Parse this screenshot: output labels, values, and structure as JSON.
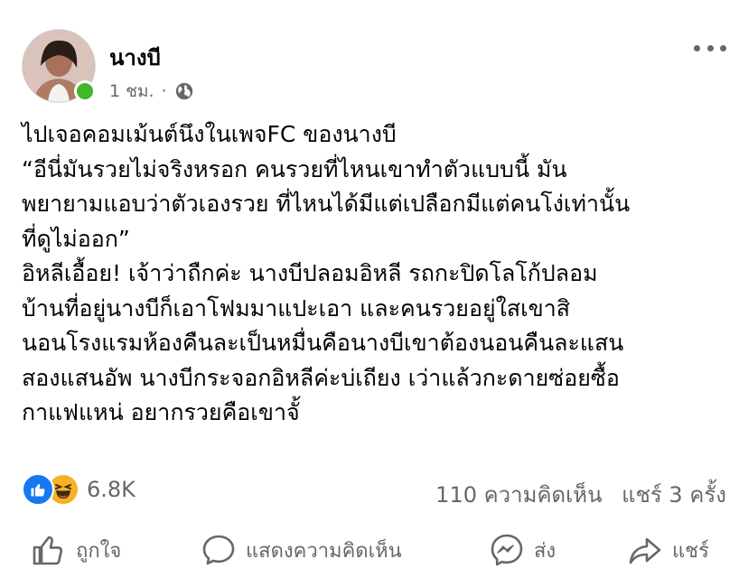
{
  "post": {
    "author": "นางบี",
    "time": "1 ชม.",
    "dot": "·",
    "lines": [
      "ไปเจอคอมเม้นต์นึงในเพจFC ของนางบี",
      "“อีนี่มันรวยไม่จริงหรอก คนรวยที่ไหนเขาทำตัวแบบนี้ มัน",
      "พยายามแอบว่าตัวเองรวย ที่ไหนได้มีแต่เปลือกมีแต่คนโง่เท่านั้น",
      "ที่ดูไม่ออก”",
      "อิหลีเอื้อย! เจ้าว่าถืกค่ะ นางบีปลอมอิหลี รถกะปิดโลโก้ปลอม",
      "บ้านที่อยู่นางบีก็เอาโฟมมาแปะเอา และคนรวยอยู่ใสเขาสิ",
      "นอนโรงแรมห้องคืนละเป็นหมื่นคือนางบีเขาต้องนอนคืนละแสน",
      "สองแสนอัพ นางบีกระจอกอิหลีค่ะบ่เถียง เว่าแล้วกะดายซ่อยซื้อ",
      "กาแฟแหน่ อยากรวยคือเขาจั้"
    ]
  },
  "stats": {
    "reaction_count": "6.8K",
    "comments": "110 ความคิดเห็น",
    "shares": "แชร์ 3 ครั้ง"
  },
  "actions": {
    "like": "ถูกใจ",
    "comment": "แสดงความคิดเห็น",
    "send": "ส่ง",
    "share": "แชร์"
  },
  "colors": {
    "online": "#42b72a",
    "like_blue": "#1877f2",
    "haha_yellow": "#f7b125",
    "secondary_text": "#65676b"
  },
  "icons": [
    "globe-icon",
    "more-icon",
    "like-reaction-icon",
    "haha-reaction-icon",
    "thumbs-up-icon",
    "comment-icon",
    "messenger-icon",
    "share-icon"
  ]
}
